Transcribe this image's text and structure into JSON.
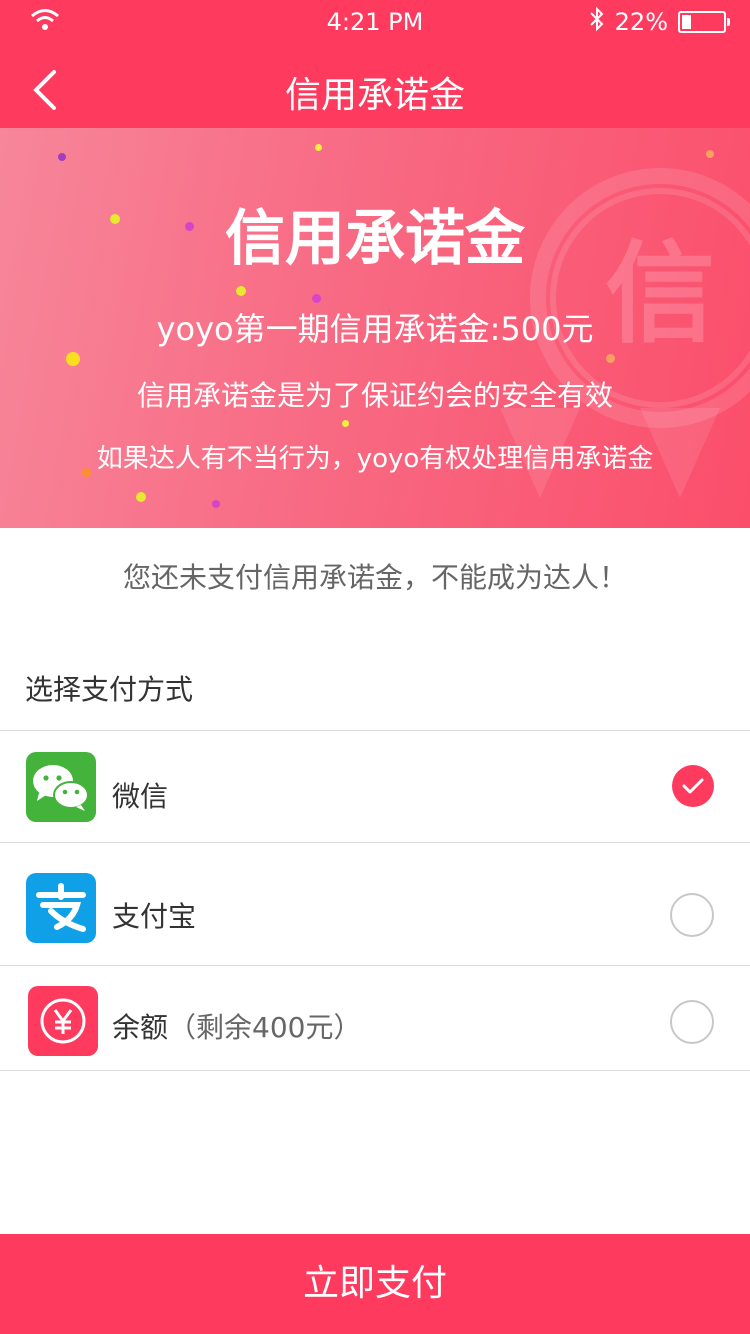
{
  "status_bar": {
    "time": "4:21 PM",
    "battery": "22%",
    "battery_level": 0.22,
    "icons": [
      "wifi-icon",
      "bluetooth-icon",
      "battery-icon"
    ]
  },
  "nav": {
    "title": "信用承诺金",
    "back_icon": "chevron-left-icon"
  },
  "hero": {
    "title": "信用承诺金",
    "line1": "yoyo第一期信用承诺金:500元",
    "line2": "信用承诺金是为了保证约会的安全有效",
    "line3": "如果达人有不当行为，yoyo有权处理信用承诺金",
    "seal_char": "信"
  },
  "notice": "您还未支付信用承诺金，不能成为达人！",
  "section_title": "选择支付方式",
  "payment_methods": [
    {
      "name": "微信",
      "sub": "",
      "icon": "wechat-icon",
      "selected": true
    },
    {
      "name": "支付宝",
      "sub": "",
      "icon": "alipay-icon",
      "selected": false
    },
    {
      "name": "余额",
      "sub": "（剩余400元）",
      "icon": "yen-icon",
      "selected": false
    }
  ],
  "pay_button": "立即支付",
  "colors": {
    "accent": "#fe3a5e",
    "text_primary": "#333333",
    "text_secondary": "#666666",
    "divider": "#dddddd",
    "wechat": "#44b33b",
    "alipay": "#10a0e8"
  }
}
